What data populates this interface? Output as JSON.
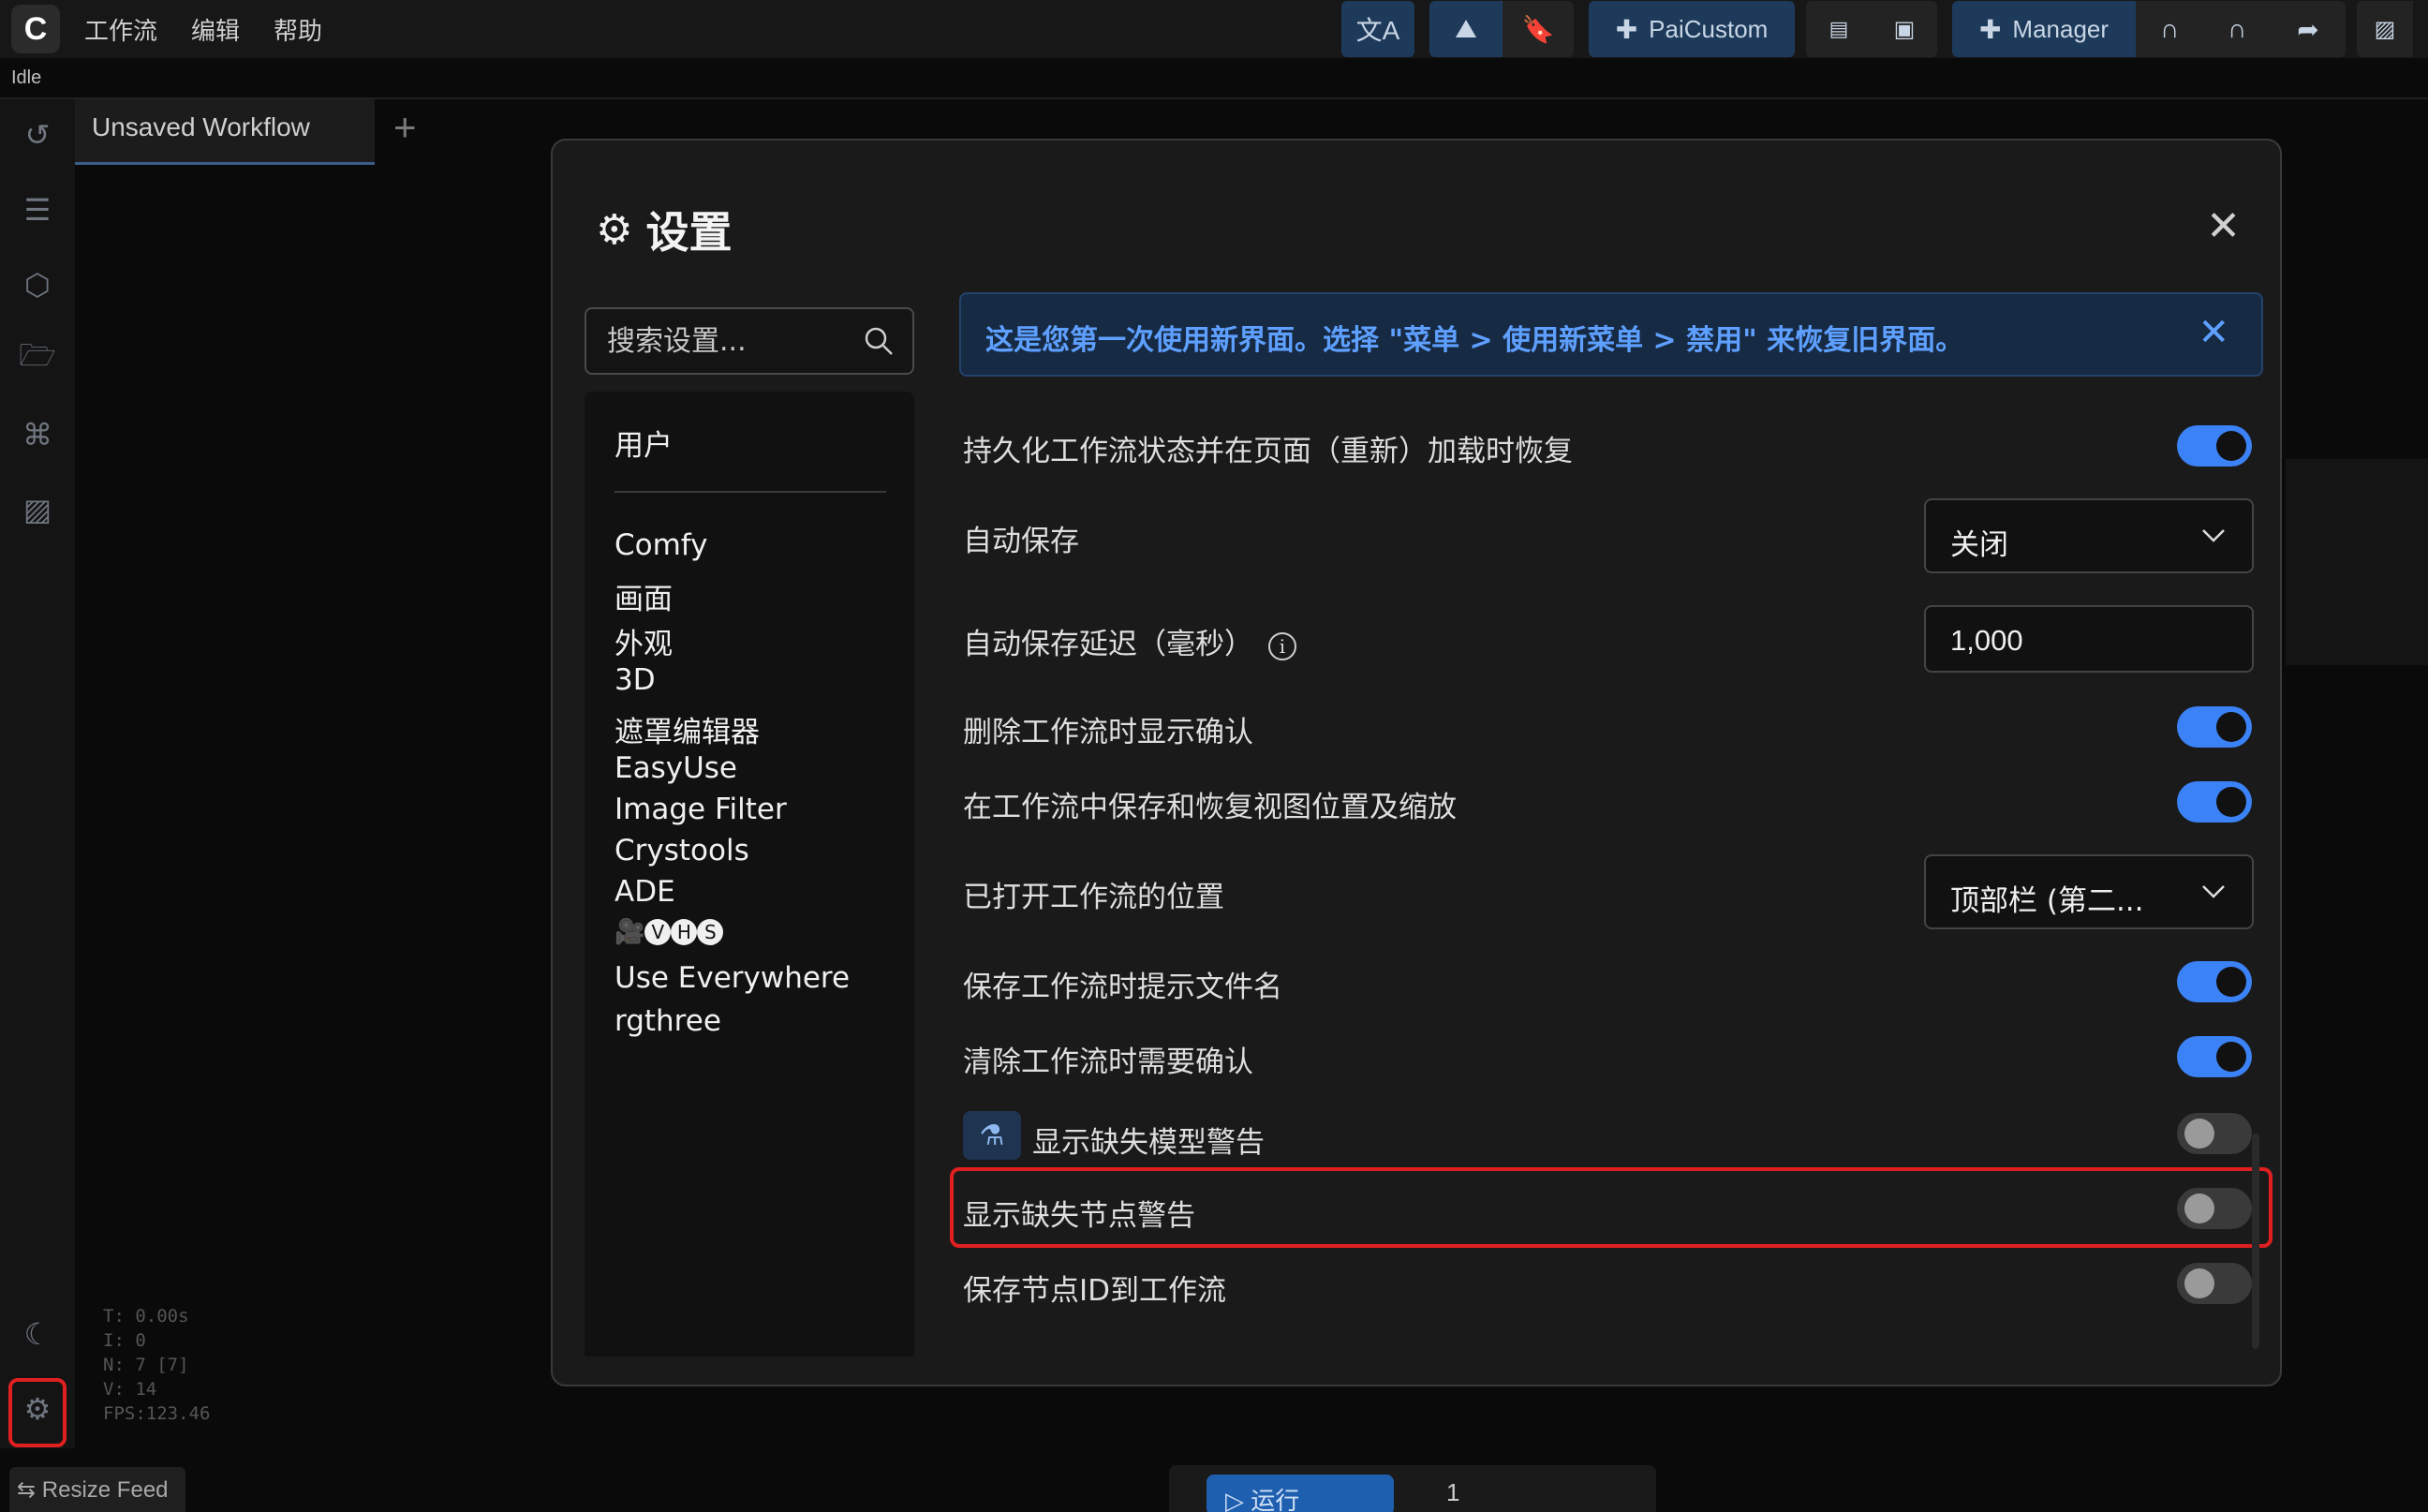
{
  "topbar": {
    "logo": "C",
    "menu": [
      "工作流",
      "编辑",
      "帮助"
    ],
    "buttons": {
      "translate_icon": "translate-icon",
      "paicustom_label": "PaiCustom",
      "manager_label": "Manager"
    }
  },
  "status": {
    "queue": "Idle"
  },
  "tabs": [
    {
      "label": "Unsaved Workflow"
    }
  ],
  "stats": {
    "t": "T: 0.00s",
    "i": "I: 0",
    "n": "N: 7 [7]",
    "v": "V: 14",
    "fps": "FPS:123.46"
  },
  "bottom": {
    "resize_feed": "Resize Feed",
    "run_label": "运行",
    "batch": "1"
  },
  "dialog": {
    "title": "设置",
    "search_placeholder": "搜索设置...",
    "nav": [
      "用户",
      "Comfy",
      "画面",
      "外观",
      "3D",
      "遮罩编辑器",
      "EasyUse",
      "Image Filter",
      "Crystools",
      "ADE",
      "VHS",
      "Use Everywhere",
      "rgthree"
    ],
    "nav_vhs_prefix": "🎥",
    "nav_vhs_letters": [
      "V",
      "H",
      "S"
    ],
    "banner": "这是您第一次使用新界面。选择 \"菜单 > 使用新菜单 > 禁用\" 来恢复旧界面。",
    "settings": [
      {
        "label": "持久化工作流状态并在页面（重新）加载时恢复",
        "type": "toggle",
        "on": true
      },
      {
        "label": "自动保存",
        "type": "select",
        "value": "关闭"
      },
      {
        "label": "自动保存延迟（毫秒）",
        "type": "number",
        "value": "1,000"
      },
      {
        "label": "删除工作流时显示确认",
        "type": "toggle",
        "on": true
      },
      {
        "label": "在工作流中保存和恢复视图位置及缩放",
        "type": "toggle",
        "on": true
      },
      {
        "label": "已打开工作流的位置",
        "type": "select",
        "value": "顶部栏 (第二..."
      },
      {
        "label": "保存工作流时提示文件名",
        "type": "toggle",
        "on": true
      },
      {
        "label": "清除工作流时需要确认",
        "type": "toggle",
        "on": true
      },
      {
        "label": "显示缺失模型警告",
        "type": "toggle",
        "on": false
      },
      {
        "label": "显示缺失节点警告",
        "type": "toggle",
        "on": false
      },
      {
        "label": "保存节点ID到工作流",
        "type": "toggle",
        "on": false
      }
    ]
  },
  "colors": {
    "accent": "#3b82f6",
    "highlight": "#e02020",
    "banner_text": "#5ea0ff"
  }
}
